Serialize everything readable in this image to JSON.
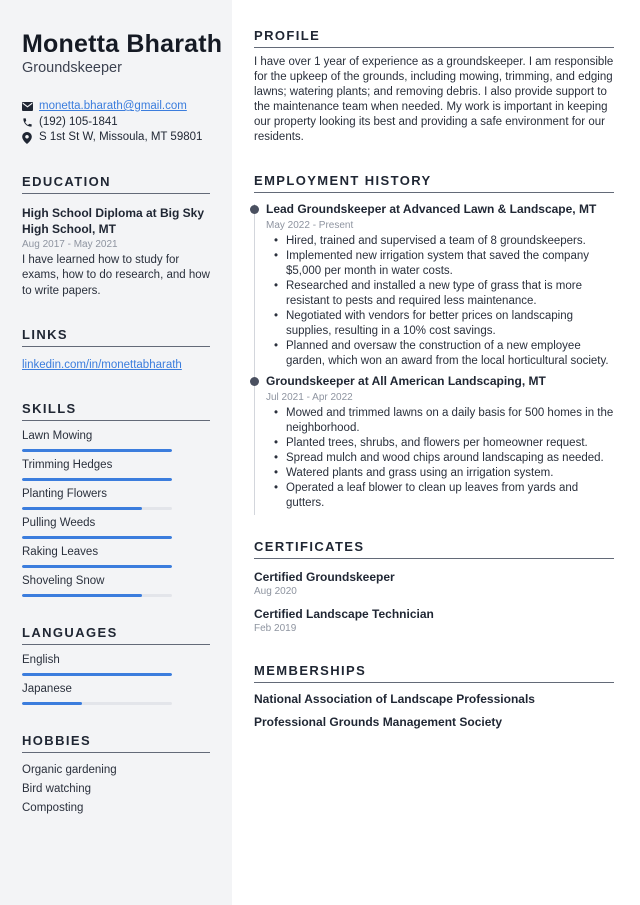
{
  "header": {
    "name": "Monetta Bharath",
    "job_title": "Groundskeeper"
  },
  "contact": {
    "email": "monetta.bharath@gmail.com",
    "phone": "(192) 105-1841",
    "address": "S 1st St W, Missoula, MT 59801",
    "icons": [
      "envelope-icon",
      "phone-icon",
      "map-pin-icon"
    ]
  },
  "education": {
    "heading": "EDUCATION",
    "title": "High School Diploma at Big Sky High School, MT",
    "dates": "Aug 2017 - May 2021",
    "description": "I have learned how to study for exams, how to do research, and how to write papers."
  },
  "links": {
    "heading": "LINKS",
    "items": [
      {
        "label": "linkedin.com/in/monettabharath"
      }
    ]
  },
  "skills": {
    "heading": "SKILLS",
    "items": [
      {
        "label": "Lawn Mowing",
        "level": 1.0
      },
      {
        "label": "Trimming Hedges",
        "level": 1.0
      },
      {
        "label": "Planting Flowers",
        "level": 0.8
      },
      {
        "label": "Pulling Weeds",
        "level": 1.0
      },
      {
        "label": "Raking Leaves",
        "level": 1.0
      },
      {
        "label": "Shoveling Snow",
        "level": 0.8
      }
    ]
  },
  "languages": {
    "heading": "LANGUAGES",
    "items": [
      {
        "label": "English",
        "level": 1.0
      },
      {
        "label": "Japanese",
        "level": 0.4
      }
    ]
  },
  "hobbies": {
    "heading": "HOBBIES",
    "items": [
      "Organic gardening",
      "Bird watching",
      "Composting"
    ]
  },
  "profile": {
    "heading": "PROFILE",
    "text": "I have over 1 year of experience as a groundskeeper. I am responsible for the upkeep of the grounds, including mowing, trimming, and edging lawns; watering plants; and removing debris. I also provide support to the maintenance team when needed. My work is important in keeping our property looking its best and providing a safe environment for our residents."
  },
  "employment": {
    "heading": "EMPLOYMENT HISTORY",
    "jobs": [
      {
        "title": "Lead Groundskeeper at Advanced Lawn & Landscape, MT",
        "dates": "May 2022 - Present",
        "bullets": [
          "Hired, trained and supervised a team of 8 groundskeepers.",
          "Implemented new irrigation system that saved the company $5,000 per month in water costs.",
          "Researched and installed a new type of grass that is more resistant to pests and required less maintenance.",
          "Negotiated with vendors for better prices on landscaping supplies, resulting in a 10% cost savings.",
          "Planned and oversaw the construction of a new employee garden, which won an award from the local horticultural society."
        ]
      },
      {
        "title": "Groundskeeper at All American Landscaping, MT",
        "dates": "Jul 2021 - Apr 2022",
        "bullets": [
          "Mowed and trimmed lawns on a daily basis for 500 homes in the neighborhood.",
          "Planted trees, shrubs, and flowers per homeowner request.",
          "Spread mulch and wood chips around landscaping as needed.",
          "Watered plants and grass using an irrigation system.",
          "Operated a leaf blower to clean up leaves from yards and gutters."
        ]
      }
    ]
  },
  "certificates": {
    "heading": "CERTIFICATES",
    "items": [
      {
        "title": "Certified Groundskeeper",
        "date": "Aug 2020"
      },
      {
        "title": "Certified Landscape Technician",
        "date": "Feb 2019"
      }
    ]
  },
  "memberships": {
    "heading": "MEMBERSHIPS",
    "items": [
      "National Association of Landscape Professionals",
      "Professional Grounds Management Society"
    ]
  },
  "colors": {
    "accent": "#3b7ddd",
    "sidebar_bg": "#f3f4f6",
    "text": "#1f2633",
    "muted": "#8e94a0",
    "rule": "#636a78"
  }
}
